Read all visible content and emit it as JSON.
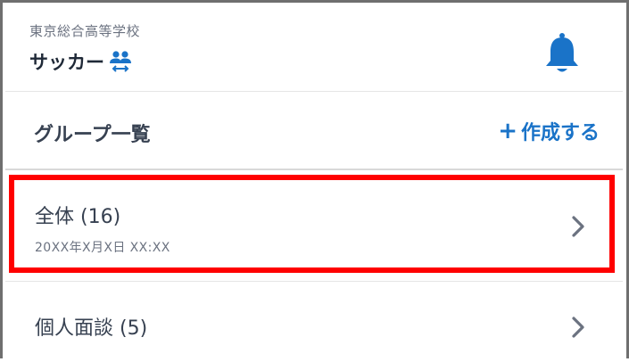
{
  "header": {
    "school_name": "東京総合高等学校",
    "team_name": "サッカー",
    "team_icon": "people-transfer-icon",
    "bell_icon": "bell-icon"
  },
  "groups": {
    "title": "グループ一覧",
    "create_label": "作成する",
    "create_plus": "+",
    "items": [
      {
        "title": "全体 (16)",
        "date": "20XX年X月X日 XX:XX",
        "highlighted": true
      },
      {
        "title": "個人面談 (5)"
      }
    ]
  },
  "colors": {
    "accent": "#1a73c8",
    "highlight": "#ff0000",
    "text_primary": "#374151",
    "text_secondary": "#6b7280"
  }
}
